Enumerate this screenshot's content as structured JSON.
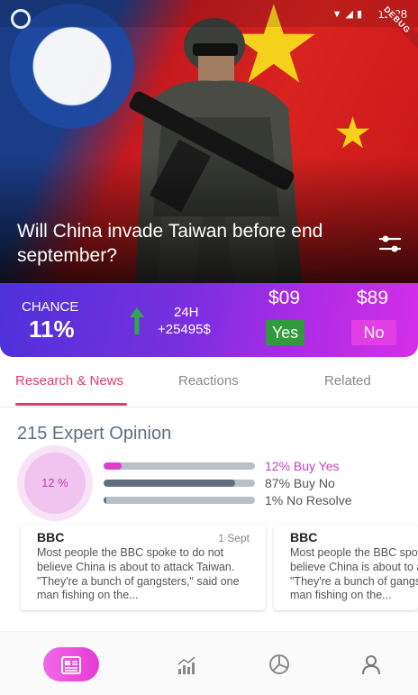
{
  "status_bar": {
    "time": "12:28",
    "debug_banner": "DEBUG"
  },
  "hero": {
    "title": "Will China invade Taiwan before end september?"
  },
  "stats": {
    "chance_label": "CHANCE",
    "chance_value": "11%",
    "trend": "up",
    "period_label": "24H",
    "period_change": "+25495$",
    "yes_price": "$09",
    "no_price": "$89",
    "yes_label": "Yes",
    "no_label": "No"
  },
  "tabs": [
    {
      "label": "Research & News",
      "active": true
    },
    {
      "label": "Reactions",
      "active": false
    },
    {
      "label": "Related",
      "active": false
    }
  ],
  "expert": {
    "title": "215 Expert Opinion",
    "circle_value": "12 %",
    "bars": [
      {
        "label": "12% Buy Yes",
        "fraction": 0.12,
        "color": "#e03ccd"
      },
      {
        "label": "87% Buy No",
        "fraction": 0.87,
        "color": "#606e7d"
      },
      {
        "label": "1% No Resolve",
        "fraction": 0.01,
        "color": "#606e7d"
      }
    ]
  },
  "news": [
    {
      "source": "BBC",
      "date": "1 Sept",
      "text": "Most people the BBC spoke to do not believe China is about to attack Taiwan. \"They're a bunch of gangsters,\" said one man fishing on the..."
    },
    {
      "source": "BBC",
      "date": "",
      "text": "Most people the BBC spoke to do not believe China is about to attack Taiwan. \"They're a bunch of gangsters,\" said one man fishing on the..."
    }
  ],
  "bottom_nav": [
    {
      "icon": "news-icon",
      "active": true
    },
    {
      "icon": "chart-icon",
      "active": false
    },
    {
      "icon": "pie-chart-icon",
      "active": false
    },
    {
      "icon": "profile-icon",
      "active": false
    }
  ],
  "colors": {
    "accent": "#e23c6c",
    "yes": "#2f9b3d",
    "no": "#e23ee6",
    "up_arrow": "#2ea84a"
  }
}
